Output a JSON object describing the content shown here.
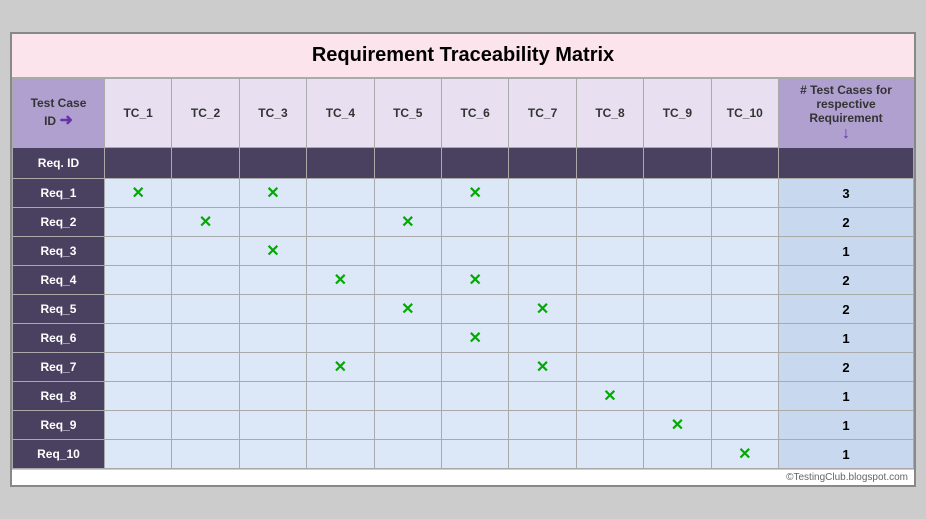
{
  "title": "Requirement Traceability Matrix",
  "header": {
    "tc_id_label": "Test Case\nID",
    "tc_id_arrow": "➜",
    "count_label": "# Test Cases for respective\nRequirement",
    "count_arrow": "↓",
    "req_id_label": "Req. ID",
    "columns": [
      "TC_1",
      "TC_2",
      "TC_3",
      "TC_4",
      "TC_5",
      "TC_6",
      "TC_7",
      "TC_8",
      "TC_9",
      "TC_10"
    ]
  },
  "rows": [
    {
      "id": "Req_1",
      "marks": [
        1,
        0,
        1,
        0,
        0,
        1,
        0,
        0,
        0,
        0
      ],
      "count": 3
    },
    {
      "id": "Req_2",
      "marks": [
        0,
        1,
        0,
        0,
        1,
        0,
        0,
        0,
        0,
        0
      ],
      "count": 2
    },
    {
      "id": "Req_3",
      "marks": [
        0,
        0,
        1,
        0,
        0,
        0,
        0,
        0,
        0,
        0
      ],
      "count": 1
    },
    {
      "id": "Req_4",
      "marks": [
        0,
        0,
        0,
        1,
        0,
        1,
        0,
        0,
        0,
        0
      ],
      "count": 2
    },
    {
      "id": "Req_5",
      "marks": [
        0,
        0,
        0,
        0,
        1,
        0,
        1,
        0,
        0,
        0
      ],
      "count": 2
    },
    {
      "id": "Req_6",
      "marks": [
        0,
        0,
        0,
        0,
        0,
        1,
        0,
        0,
        0,
        0
      ],
      "count": 1
    },
    {
      "id": "Req_7",
      "marks": [
        0,
        0,
        0,
        1,
        0,
        0,
        1,
        0,
        0,
        0
      ],
      "count": 2
    },
    {
      "id": "Req_8",
      "marks": [
        0,
        0,
        0,
        0,
        0,
        0,
        0,
        1,
        0,
        0
      ],
      "count": 1
    },
    {
      "id": "Req_9",
      "marks": [
        0,
        0,
        0,
        0,
        0,
        0,
        0,
        0,
        1,
        0
      ],
      "count": 1
    },
    {
      "id": "Req_10",
      "marks": [
        0,
        0,
        0,
        0,
        0,
        0,
        0,
        0,
        0,
        1
      ],
      "count": 1
    }
  ],
  "watermark": "©TestingClub.blogspot.com"
}
